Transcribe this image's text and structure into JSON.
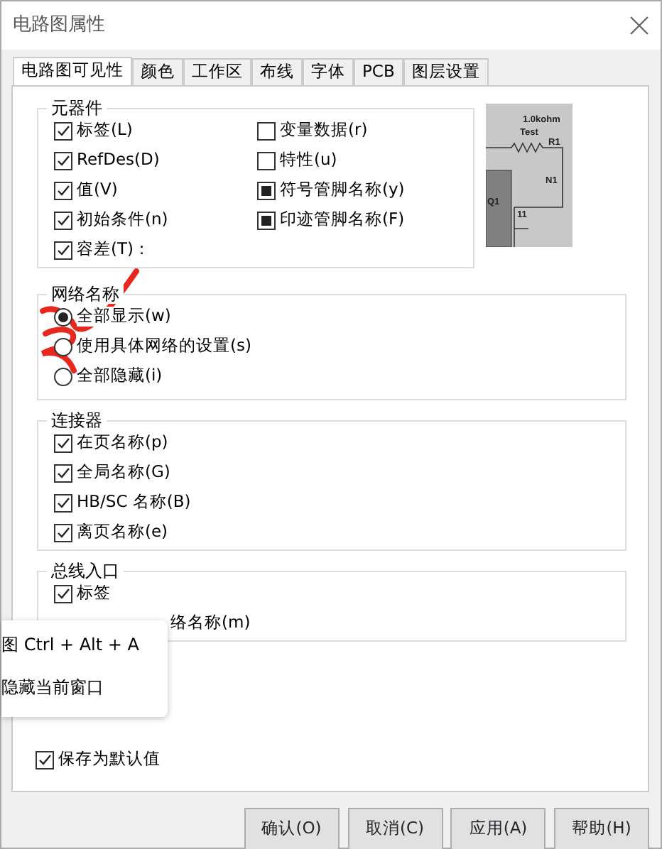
{
  "window": {
    "title": "电路图属性"
  },
  "tabs": [
    {
      "label": "电路图可见性",
      "selected": true
    },
    {
      "label": "颜色",
      "selected": false
    },
    {
      "label": "工作区",
      "selected": false
    },
    {
      "label": "布线",
      "selected": false
    },
    {
      "label": "字体",
      "selected": false
    },
    {
      "label": "PCB",
      "selected": false
    },
    {
      "label": "图层设置",
      "selected": false
    }
  ],
  "components": {
    "title": "元器件",
    "left": [
      {
        "label": "标签(L)",
        "checked": true
      },
      {
        "label": "RefDes(D)",
        "checked": true
      },
      {
        "label": "值(V)",
        "checked": true
      },
      {
        "label": "初始条件(n)",
        "checked": true
      },
      {
        "label": "容差(T)：",
        "checked": true
      }
    ],
    "right": [
      {
        "label": "变量数据(r)",
        "checked": false
      },
      {
        "label": "特性(u)",
        "checked": false
      },
      {
        "label": "符号管脚名称(y)",
        "kind": "mixed"
      },
      {
        "label": "印迹管脚名称(F)",
        "kind": "mixed"
      }
    ]
  },
  "preview": {
    "labels": [
      "1.0kohm",
      "Test",
      "R1",
      "N1",
      "Q1",
      "11"
    ]
  },
  "net_names": {
    "title": "网络名称",
    "options": [
      {
        "label": "全部显示(w)",
        "selected": true
      },
      {
        "label": "使用具体网络的设置(s)",
        "selected": false
      },
      {
        "label": "全部隐藏(i)",
        "selected": false
      }
    ]
  },
  "connectors": {
    "title": "连接器",
    "items": [
      {
        "label": "在页名称(p)",
        "checked": true
      },
      {
        "label": "全局名称(G)",
        "checked": true
      },
      {
        "label": "HB/SC 名称(B)",
        "checked": true
      },
      {
        "label": "离页名称(e)",
        "checked": true
      }
    ]
  },
  "bus_entry": {
    "title": "总线入口",
    "items": [
      {
        "label": "标签",
        "checked": true
      },
      {
        "label": "络名称(m)",
        "kind": "covered"
      }
    ]
  },
  "popup": {
    "lines": [
      "图 Ctrl + Alt + A",
      "隐藏当前窗口"
    ]
  },
  "save_default": {
    "label": "保存为默认值",
    "checked": true
  },
  "buttons": [
    "确认(O)",
    "取消(C)",
    "应用(A)",
    "帮助(H)"
  ]
}
